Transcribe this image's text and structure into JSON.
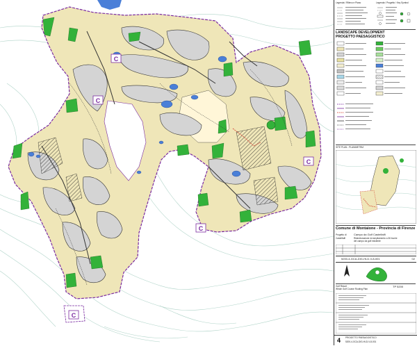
{
  "map": {
    "club_markers": [
      "C",
      "C",
      "C",
      "C",
      "C"
    ],
    "colors": {
      "background": "#ffffff",
      "contour": "#7fb8a8",
      "boundary": "#7a2aa0",
      "rough": "#efe6b8",
      "fairway": "#d6d6d6",
      "tree_green": "#33b23a",
      "water": "#4a7fd8",
      "path": "#333333"
    }
  },
  "panel": {
    "legend_top_left": "Legenda / Rilievo e Piano",
    "legend_top_right": "Legenda / Progetto / Key Symbol",
    "section_title_1": "LANDSCAPE DEVELOPMENT",
    "section_title_2": "PROGETTO PAESAGGISTICO",
    "site_plan_label": "SITE PLAN - PLANIMETRIA",
    "comune_title": "Comune di Montaione - Provincia di Firenze",
    "project_label": "Progetto di",
    "project_sub": "Castelfalfi",
    "project_name": "Campo da Golf Castelfalfi",
    "project_desc_1": "Ristrutturazione ed ampliamento a 36 buche",
    "project_desc_2": "del campo da golf esistente",
    "drawing_number": "5200-4-GCA-DIG-HLD-V-8-001",
    "drawing_rev": "02",
    "client_1": "Golf Resort",
    "client_2": "Whole Golf Course Routing Plan",
    "tp_code": "TP 5200",
    "footer_number": "4",
    "footer_title": "PROGETTO PAESAGGISTICO",
    "footer_code": "5200-4-GCA-DIG-HLD-V-8-001"
  }
}
